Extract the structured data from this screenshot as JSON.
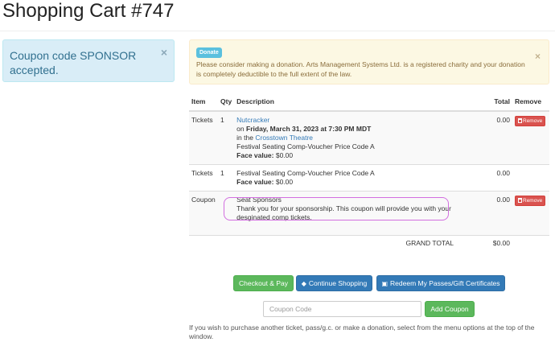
{
  "page": {
    "title": "Shopping Cart #747"
  },
  "info_alert": {
    "text": "Coupon code SPONSOR accepted.",
    "close": "×"
  },
  "donation_alert": {
    "badge": "Donate",
    "text": "Please consider making a donation. Arts Management Systems Ltd. is a registered charity and your donation is completely deductible to the full extent of the law.",
    "close": "×"
  },
  "cart": {
    "headers": {
      "item": "Item",
      "qty": "Qty",
      "description": "Description",
      "total": "Total",
      "remove": "Remove"
    },
    "rows": [
      {
        "item": "Tickets",
        "qty": "1",
        "event_link": "Nutcracker",
        "date_prefix": "on",
        "date": "Friday, March 31, 2023 at 7:30 PM MDT",
        "venue_prefix": "in the",
        "venue": "Crosstown Theatre",
        "price_code": "Festival Seating Comp-Voucher Price Code A",
        "face_label": "Face value:",
        "face_value": "$0.00",
        "total": "0.00",
        "remove_label": "Remove"
      },
      {
        "item": "Tickets",
        "qty": "1",
        "price_code": "Festival Seating Comp-Voucher Price Code A",
        "face_label": "Face value:",
        "face_value": "$0.00",
        "total": "0.00"
      },
      {
        "item": "Coupon",
        "title": "Seat Sponsors",
        "note": "Thank you for your sponsorship. This coupon will provide you with your desginated comp tickets.",
        "total": "0.00",
        "remove_label": "Remove"
      }
    ],
    "grand_total_label": "GRAND TOTAL",
    "grand_total": "$0.00"
  },
  "actions": {
    "checkout": "Checkout & Pay",
    "continue": "Continue Shopping",
    "redeem": "Redeem My Passes/Gift Certificates",
    "coupon_placeholder": "Coupon Code",
    "add_coupon": "Add Coupon"
  },
  "footer": {
    "text": "If you wish to purchase another ticket, pass/g.c. or make a donation, select from the menu options at the top of the window."
  },
  "colors": {
    "success": "#5cb85c",
    "primary": "#337ab7",
    "danger": "#d9534f",
    "info_bg": "#d9edf7",
    "warning_bg": "#fcf8e3",
    "annotation": "#d26ee0"
  }
}
